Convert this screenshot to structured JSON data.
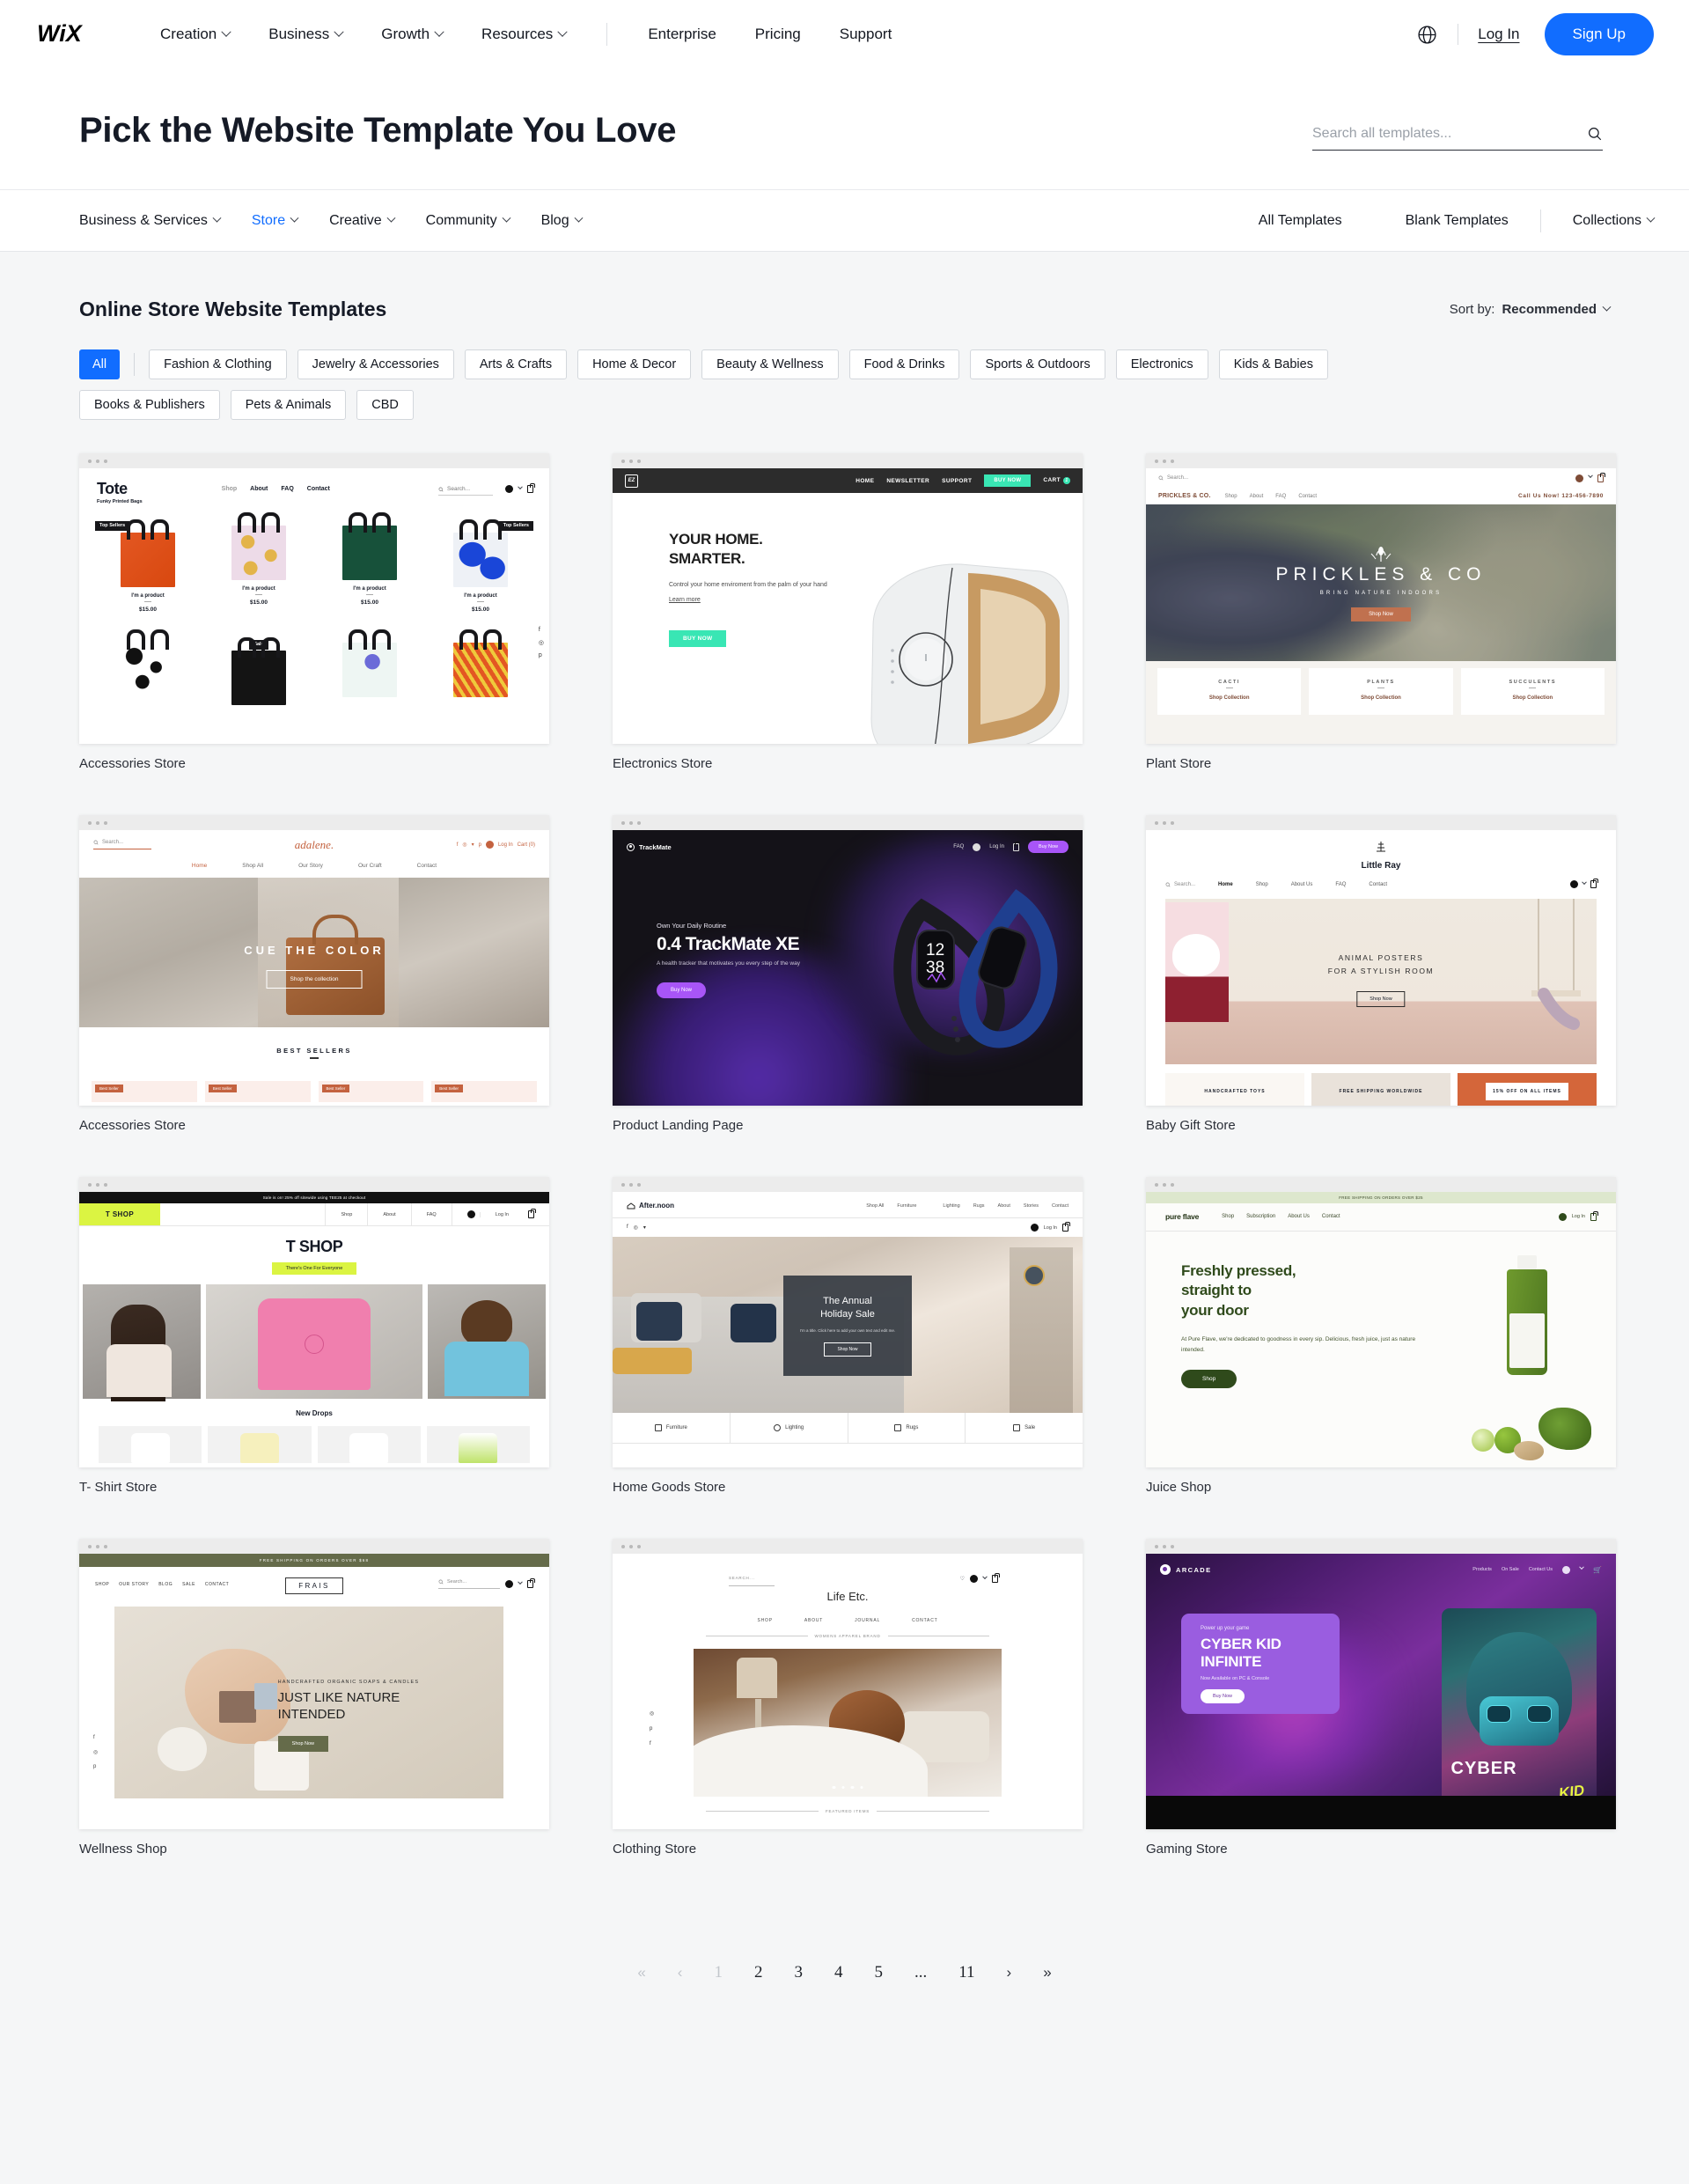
{
  "brand": {
    "logo_text": "WIX"
  },
  "topnav": {
    "items": [
      {
        "label": "Creation",
        "has_caret": true
      },
      {
        "label": "Business",
        "has_caret": true
      },
      {
        "label": "Growth",
        "has_caret": true
      },
      {
        "label": "Resources",
        "has_caret": true
      }
    ],
    "items2": [
      {
        "label": "Enterprise",
        "has_caret": false
      },
      {
        "label": "Pricing",
        "has_caret": false
      },
      {
        "label": "Support",
        "has_caret": false
      }
    ],
    "globe_icon": "globe-icon",
    "login_label": "Log In",
    "signup_label": "Sign Up",
    "signup_color": "#116dff"
  },
  "header": {
    "title": "Pick the Website Template You Love",
    "search_placeholder": "Search all templates...",
    "search_value": "",
    "search_icon": "search-icon"
  },
  "catbar": {
    "left": [
      {
        "label": "Business & Services",
        "active": false
      },
      {
        "label": "Store",
        "active": true
      },
      {
        "label": "Creative",
        "active": false
      },
      {
        "label": "Community",
        "active": false
      },
      {
        "label": "Blog",
        "active": false
      }
    ],
    "right": [
      {
        "label": "All Templates",
        "caret": false
      },
      {
        "label": "Blank Templates",
        "caret": false
      },
      {
        "label": "Collections",
        "caret": true
      }
    ]
  },
  "section": {
    "title": "Online Store Website Templates",
    "sort_prefix": "Sort by:",
    "sort_value": "Recommended"
  },
  "filters": {
    "selected": "All",
    "chips": [
      "All",
      "Fashion & Clothing",
      "Jewelry & Accessories",
      "Arts & Crafts",
      "Home & Decor",
      "Beauty & Wellness",
      "Food & Drinks",
      "Sports & Outdoors",
      "Electronics",
      "Kids & Babies",
      "Books & Publishers",
      "Pets & Animals",
      "CBD"
    ]
  },
  "templates": [
    {
      "label": "Accessories Store",
      "site": {
        "logo": "Tote",
        "tagline": "Funky Printed Bags",
        "nav": [
          "Shop",
          "About",
          "FAQ",
          "Contact"
        ],
        "search_placeholder": "Search...",
        "badges": [
          "Top Sellers",
          "Sale"
        ],
        "product_name": "I'm a product",
        "product_price": "$15.00",
        "socials": [
          "f",
          "◎",
          "p"
        ]
      }
    },
    {
      "label": "Electronics Store",
      "site": {
        "logo": "EZ",
        "nav": [
          "HOME",
          "NEWSLETTER",
          "SUPPORT"
        ],
        "nav_cta": "BUY NOW",
        "cart_label": "CART",
        "cart_count": "1",
        "headline_1": "YOUR HOME.",
        "headline_2": "SMARTER.",
        "body": "Control your home enviroment from the palm of your hand",
        "link": "Learn more",
        "cta": "BUY NOW",
        "accent": "#39e6b4"
      }
    },
    {
      "label": "Plant Store",
      "site": {
        "logo": "PRICKLES & CO.",
        "nav": [
          "Shop",
          "About",
          "FAQ",
          "Contact"
        ],
        "search_placeholder": "Search...",
        "phone": "Call Us Now! 123-456-7890",
        "hero_title": "PRICKLES & CO",
        "hero_sub": "BRING NATURE INDOORS",
        "hero_cta": "Shop Now",
        "cards": [
          {
            "name": "CACTI",
            "link": "Shop Collection"
          },
          {
            "name": "PLANTS",
            "link": "Shop Collection"
          },
          {
            "name": "SUCCULENTS",
            "link": "Shop Collection"
          }
        ]
      }
    },
    {
      "label": "Accessories Store",
      "site": {
        "logo": "adalene.",
        "search_placeholder": "Search...",
        "nav": [
          "Home",
          "Shop All",
          "Our Story",
          "Our Craft",
          "Contact"
        ],
        "login": "Log In",
        "cart": "Cart (0)",
        "hero_title": "CUE THE COLOR",
        "hero_cta": "Shop the collection",
        "section": "BEST SELLERS",
        "badge": "Best Seller"
      }
    },
    {
      "label": "Product Landing Page",
      "site": {
        "logo": "TrackMate",
        "nav": [
          "FAQ"
        ],
        "login": "Log In",
        "nav_cta": "Buy Now",
        "kicker": "Own Your Daily Routine",
        "headline": "0.4 TrackMate XE",
        "body": "A health tracker that motivates you every step of the way",
        "cta": "Buy Now",
        "watch_time_1": "12",
        "watch_time_2": "38",
        "accent": "#a855f7"
      }
    },
    {
      "label": "Baby Gift Store",
      "site": {
        "logo": "Little Ray",
        "search_placeholder": "Search...",
        "nav": [
          "Home",
          "Shop",
          "About Us",
          "FAQ",
          "Contact"
        ],
        "hero_title_1": "ANIMAL POSTERS",
        "hero_title_2": "FOR A STYLISH ROOM",
        "hero_cta": "Shop Now",
        "tiles": [
          "HANDCRAFTED TOYS",
          "FREE SHIPPING WORLDWIDE",
          "15% OFF ON ALL ITEMS"
        ]
      }
    },
    {
      "label": "T- Shirt Store",
      "site": {
        "announcement": "Sale is on! 25% off sitewide using TEE25 at checkout",
        "logo": "T SHOP",
        "nav": [
          "Shop",
          "About",
          "FAQ"
        ],
        "login": "Log In",
        "hero_title": "T SHOP",
        "hero_tag": "There's One For Everyone",
        "section": "New Drops",
        "accent": "#dbf442"
      }
    },
    {
      "label": "Home Goods Store",
      "site": {
        "logo": "After.noon",
        "nav": [
          "Shop All",
          "Furniture",
          "Lighting",
          "Rugs",
          "About",
          "Stories",
          "Contact"
        ],
        "login": "Log In",
        "hero_title_1": "The Annual",
        "hero_title_2": "Holiday Sale",
        "hero_body": "I'm a title. Click here to add your own text and edit me.",
        "hero_cta": "Shop Now",
        "categories": [
          "Furniture",
          "Lighting",
          "Rugs",
          "Sale"
        ]
      }
    },
    {
      "label": "Juice Shop",
      "site": {
        "announcement": "FREE SHIPPING ON ORDERS OVER $25",
        "logo": "pure flave",
        "nav": [
          "Shop",
          "Subscription",
          "About Us",
          "Contact"
        ],
        "login": "Log In",
        "headline_1": "Freshly pressed,",
        "headline_2": "straight to",
        "headline_3": "your door",
        "body": "At Pure Flave, we're dedicated to goodness in every sip. Delicious, fresh juice, just as nature intended.",
        "cta": "Shop"
      }
    },
    {
      "label": "Wellness Shop",
      "site": {
        "announcement": "FREE SHIPPING ON ORDERS OVER $68",
        "logo": "FRAIS",
        "nav": [
          "SHOP",
          "OUR STORY",
          "BLOG",
          "SALE",
          "CONTACT"
        ],
        "search_placeholder": "Search...",
        "kicker": "HANDCRAFTED ORGANIC SOAPS & CANDLES",
        "headline_1": "JUST LIKE NATURE",
        "headline_2": "INTENDED",
        "cta": "Shop Now",
        "socials": [
          "f",
          "◎",
          "p"
        ]
      }
    },
    {
      "label": "Clothing Store",
      "site": {
        "logo": "Life Etc.",
        "search_placeholder": "SEARCH...",
        "nav": [
          "SHOP",
          "ABOUT",
          "JOURNAL",
          "CONTACT"
        ],
        "divider_1": "WOMENS APPAREL BRAND",
        "divider_2": "FEATURED ITEMS",
        "socials": [
          "◎",
          "p",
          "f"
        ]
      }
    },
    {
      "label": "Gaming Store",
      "site": {
        "logo": "ARCADE",
        "nav": [
          "Products",
          "On Sale",
          "Contact Us"
        ],
        "kicker": "Power up your game",
        "headline_1": "CYBER KID",
        "headline_2": "INFINITE",
        "body": "Now Available on PC & Console",
        "cta": "Buy Now",
        "art_text_1": "CYBER",
        "art_text_2": "KID",
        "accent": "#9a5de0"
      }
    }
  ],
  "pagination": {
    "first": "«",
    "prev": "‹",
    "next": "›",
    "last": "»",
    "pages": [
      "1",
      "2",
      "3",
      "4",
      "5",
      "...",
      "11"
    ],
    "current": "1"
  }
}
